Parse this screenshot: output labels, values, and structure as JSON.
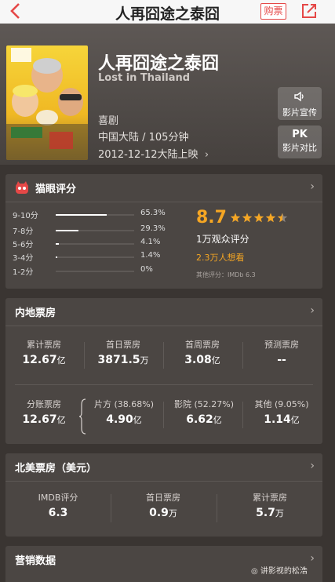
{
  "nav": {
    "title": "人再囧途之泰囧",
    "buy_label": "购票"
  },
  "movie": {
    "title": "人再囧途之泰囧",
    "title_en": "Lost in Thailand",
    "genre": "喜剧",
    "region_duration": "中国大陆 / 105分钟",
    "release": "2012-12-12大陆上映",
    "promo_label": "影片宣传",
    "pk_icon": "PK",
    "pk_label": "影片对比"
  },
  "rating": {
    "section_title": "猫眼评分",
    "score": "8.7",
    "stars_filled": 4.5,
    "count_text": "1万观众评分",
    "want_text": "2.3万人想看",
    "imdb_text": "其他评分：IMDb 6.3",
    "distribution": [
      {
        "label": "9-10分",
        "pct": "65.3%",
        "value": 65.3
      },
      {
        "label": "7-8分",
        "pct": "29.3%",
        "value": 29.3
      },
      {
        "label": "5-6分",
        "pct": "4.1%",
        "value": 4.1
      },
      {
        "label": "3-4分",
        "pct": "1.4%",
        "value": 1.4
      },
      {
        "label": "1-2分",
        "pct": "0%",
        "value": 0
      }
    ]
  },
  "mainland": {
    "section_title": "内地票房",
    "row1": [
      {
        "key": "累计票房",
        "num": "12.67",
        "unit": "亿"
      },
      {
        "key": "首日票房",
        "num": "3871.5",
        "unit": "万"
      },
      {
        "key": "首周票房",
        "num": "3.08",
        "unit": "亿"
      },
      {
        "key": "预测票房",
        "num": "--",
        "unit": ""
      }
    ],
    "split": {
      "key": "分账票房",
      "num": "12.67",
      "unit": "亿"
    },
    "row2": [
      {
        "key": "片方 (38.68%)",
        "num": "4.90",
        "unit": "亿"
      },
      {
        "key": "影院 (52.27%)",
        "num": "6.62",
        "unit": "亿"
      },
      {
        "key": "其他 (9.05%)",
        "num": "1.14",
        "unit": "亿"
      }
    ]
  },
  "northamerica": {
    "section_title": "北美票房（美元）",
    "stats": [
      {
        "key": "IMDB评分",
        "num": "6.3",
        "unit": ""
      },
      {
        "key": "首日票房",
        "num": "0.9",
        "unit": "万"
      },
      {
        "key": "累计票房",
        "num": "5.7",
        "unit": "万"
      }
    ]
  },
  "marketing": {
    "section_title": "营销数据"
  },
  "watermark": "讲影视的松浩"
}
